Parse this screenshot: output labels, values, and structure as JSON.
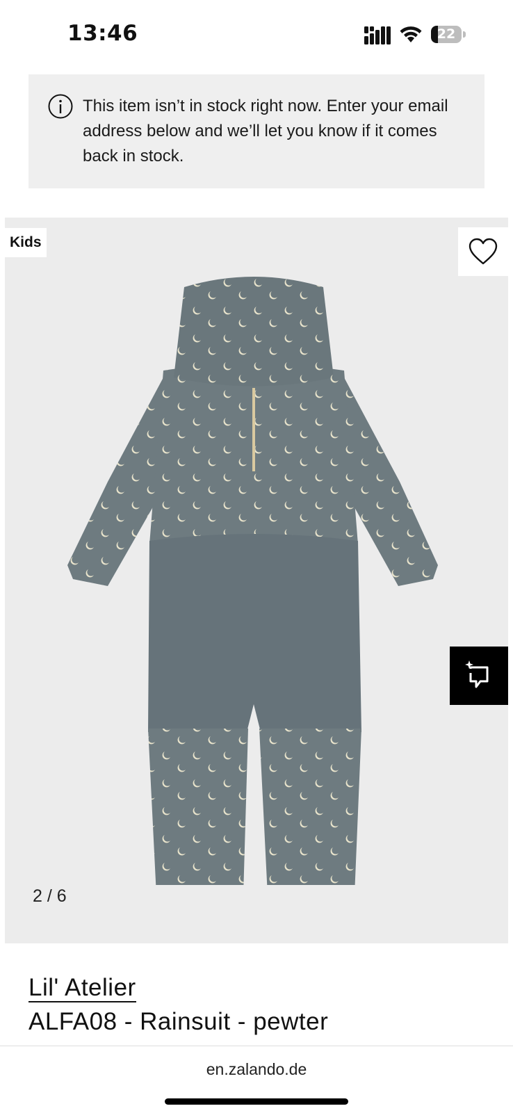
{
  "status_bar": {
    "time": "13:46",
    "battery_level": "22",
    "battery_fraction": 0.22
  },
  "notice": {
    "icon": "info-icon",
    "message": "This item isn’t in stock right now. Enter your email address below and we’ll let you know if it comes back in stock."
  },
  "product_image": {
    "badge": "Kids",
    "counter": "2 / 6",
    "wishlist_icon": "heart-icon",
    "similar_icon": "crop-sparkle-icon",
    "background_color": "#ececec"
  },
  "product": {
    "brand": "Lil' Atelier",
    "name": "ALFA08 - Rainsuit - pewter",
    "color": "#6e7b80"
  },
  "browser": {
    "url": "en.zalando.de"
  }
}
